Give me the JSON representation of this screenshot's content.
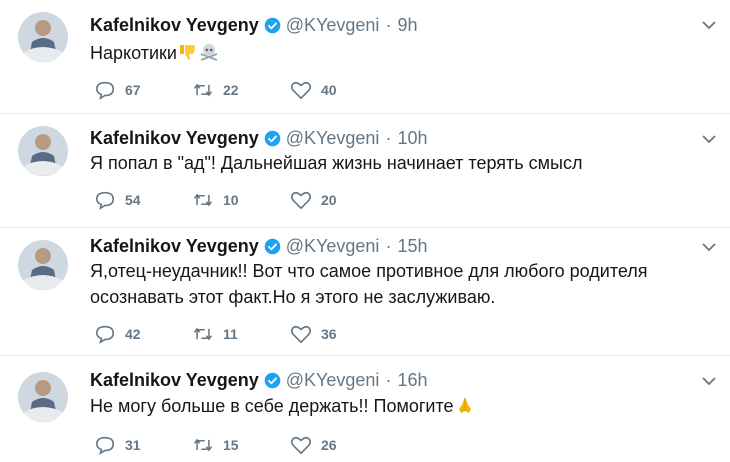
{
  "tweets": [
    {
      "author": "Kafelnikov Yevgeny",
      "handle": "@KYevgeni",
      "separator": "·",
      "time": "9h",
      "text": "Наркотики",
      "emojis": [
        "thumbs-down-icon",
        "skull-crossbones-icon"
      ],
      "replies": "67",
      "retweets": "22",
      "likes": "40"
    },
    {
      "author": "Kafelnikov Yevgeny",
      "handle": "@KYevgeni",
      "separator": "·",
      "time": "10h",
      "text": "Я попал в \"ад\"! Дальнейшая жизнь начинает терять смысл",
      "emojis": [],
      "replies": "54",
      "retweets": "10",
      "likes": "20"
    },
    {
      "author": "Kafelnikov Yevgeny",
      "handle": "@KYevgeni",
      "separator": "·",
      "time": "15h",
      "text_line1": "Я,отец-неудачник!! Вот что самое противное для любого родителя",
      "text_line2": "осознавать этот факт.Но я этого не заслуживаю.",
      "emojis": [],
      "replies": "42",
      "retweets": "11",
      "likes": "36"
    },
    {
      "author": "Kafelnikov Yevgeny",
      "handle": "@KYevgeni",
      "separator": "·",
      "time": "16h",
      "text": "Не могу больше в себе держать!! Помогите",
      "emojis": [
        "folded-hands-icon"
      ],
      "replies": "31",
      "retweets": "15",
      "likes": "26"
    }
  ],
  "colors": {
    "text": "#14171a",
    "secondary": "#657786",
    "verified": "#1da1f2",
    "divider": "#e6ecf0"
  },
  "icons": [
    "reply-icon",
    "retweet-icon",
    "like-icon",
    "verified-badge-icon",
    "chevron-down-icon"
  ]
}
